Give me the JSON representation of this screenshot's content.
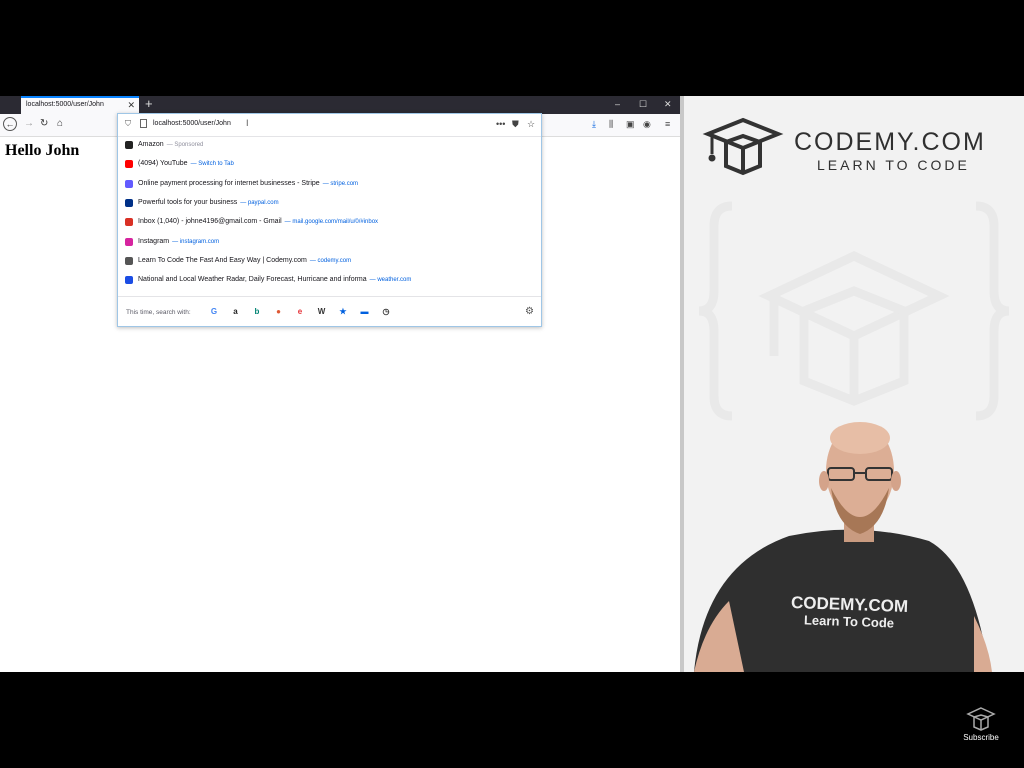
{
  "browser": {
    "tab_title": "localhost:5000/user/John",
    "tab_close": "✕",
    "new_tab": "+",
    "window_controls": [
      "–",
      "☐",
      "✕"
    ],
    "url_typed": "localhost:5000/user/John",
    "page_heading": "Hello John"
  },
  "suggestions": [
    {
      "icon": "amazon-icon",
      "icon_color": "#222222",
      "title": "Amazon",
      "meta": "— Sponsored",
      "meta_style": "grey"
    },
    {
      "icon": "youtube-icon",
      "icon_color": "#ff0000",
      "title": "(4094) YouTube",
      "meta": "— Switch to Tab",
      "meta_style": "link"
    },
    {
      "icon": "stripe-icon",
      "icon_color": "#635bff",
      "title": "Online payment processing for internet businesses - Stripe",
      "meta": "— stripe.com",
      "meta_style": "link"
    },
    {
      "icon": "paypal-icon",
      "icon_color": "#003087",
      "title": "Powerful tools for your business",
      "meta": "— paypal.com",
      "meta_style": "link"
    },
    {
      "icon": "gmail-icon",
      "icon_color": "#d93025",
      "title": "Inbox (1,040) - johne4196@gmail.com - Gmail",
      "meta": "— mail.google.com/mail/u/0/#inbox",
      "meta_style": "link"
    },
    {
      "icon": "instagram-icon",
      "icon_color": "#d6249f",
      "title": "Instagram",
      "meta": "— instagram.com",
      "meta_style": "link"
    },
    {
      "icon": "codemy-icon",
      "icon_color": "#555555",
      "title": "Learn To Code The Fast And Easy Way | Codemy.com",
      "meta": "— codemy.com",
      "meta_style": "link"
    },
    {
      "icon": "weather-icon",
      "icon_color": "#1b4de4",
      "title": "National and Local Weather Radar, Daily Forecast, Hurricane and informa",
      "meta": "— weather.com",
      "meta_style": "link"
    }
  ],
  "search_with": {
    "label": "This time, search with:",
    "engines": [
      {
        "name": "google-engine-icon",
        "glyph": "G",
        "color": "#4285f4"
      },
      {
        "name": "amazon-engine-icon",
        "glyph": "a",
        "color": "#222222"
      },
      {
        "name": "bing-engine-icon",
        "glyph": "b",
        "color": "#008373"
      },
      {
        "name": "duckduckgo-engine-icon",
        "glyph": "●",
        "color": "#de5833"
      },
      {
        "name": "ebay-engine-icon",
        "glyph": "e",
        "color": "#e53238"
      },
      {
        "name": "wikipedia-engine-icon",
        "glyph": "W",
        "color": "#333333"
      },
      {
        "name": "bookmarks-engine-icon",
        "glyph": "★",
        "color": "#0060df"
      },
      {
        "name": "tabs-engine-icon",
        "glyph": "▬",
        "color": "#0060df"
      },
      {
        "name": "history-engine-icon",
        "glyph": "◷",
        "color": "#333333"
      }
    ]
  },
  "brand": {
    "name": "CODEMY.COM",
    "tagline": "LEARN TO CODE",
    "shirt_line1": "CODEMY.COM",
    "shirt_line2": "Learn To Code"
  },
  "subscribe": {
    "label": "Subscribe"
  }
}
